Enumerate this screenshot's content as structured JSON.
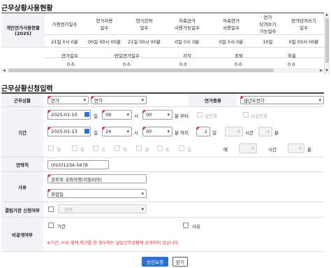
{
  "status": {
    "title": "근무상황사용현황",
    "row_label": "개인연가사용현황 (2025)",
    "headers": [
      "가용연가일수",
      "연가사용\n일수",
      "연가잔여\n일수",
      "저축연가\n사용가능일수",
      "저축연가\n사용일수",
      "연가\n당겨쓰기\n가능일수",
      "연가당겨쓰기\n일수"
    ],
    "values": [
      "21일 0시 0분",
      "00일 00시 00분",
      "21일 00시 00분",
      "0일 0시 0분",
      "0일 0시 0분",
      "10일",
      "0일 00시 00분"
    ],
    "headers2": [
      "연가일수",
      "반일연가일수",
      "지각",
      "조퇴",
      "외출"
    ],
    "values2": [
      "0.0",
      "0.0",
      "0.0",
      "0.0",
      "0.0"
    ]
  },
  "form": {
    "title": "근무상황신청입력",
    "labels": {
      "work_status": "근무상황",
      "leave_type": "연가종류",
      "period": "기간",
      "contact": "연락처",
      "reason": "사유",
      "approval": "결임기관 신청여부",
      "private": "비공개여부"
    },
    "work_status_1": "연가",
    "work_status_2": "연가",
    "leave_type_value": "금년도연가",
    "start_date": "2025-01-10",
    "end_date": "2025-01-13",
    "start_day_suffix": "일",
    "end_day_suffix": "일",
    "start_hour": "09",
    "start_min": "00",
    "end_hour": "24",
    "end_min": "00",
    "hour_suffix": "시",
    "min_suffix_start": "분 부터",
    "min_suffix_end": "분 까지",
    "half_day": "일반복",
    "weekday_repeat": "요일반복",
    "count_days": "2",
    "count_day_unit": "일",
    "count_hours": "0",
    "count_hour_unit": "시간",
    "count_mins": "0",
    "count_min_unit": "분",
    "weekdays": [
      "월",
      "화",
      "수",
      "목",
      "금",
      "토",
      "일"
    ],
    "repeat_every": "매",
    "repeat_hours_value": "0",
    "repeat_hours_unit": "시간",
    "repeat_mins_value": "0",
    "repeat_mins_unit": "분",
    "contact_value": "(010)1234-5678",
    "reason_value": "공무외 국외여행(이탈리아)",
    "reason_select": "휴업일",
    "approval_select": "선택",
    "private_period": "기간",
    "private_reason": "사유",
    "notice": "※기간, 사유 옆에 체크를 한 경우에는 일일근무상황에 공개되지 않습니다.",
    "submit": "승인요청",
    "close": "닫기"
  }
}
